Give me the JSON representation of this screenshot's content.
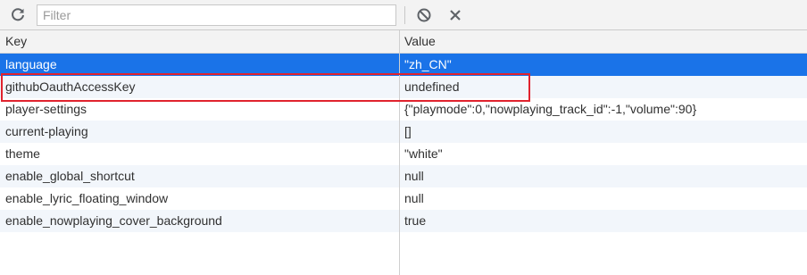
{
  "toolbar": {
    "filter_placeholder": "Filter",
    "refresh_icon": "refresh-icon",
    "clear_icon": "block-icon",
    "close_icon": "close-icon"
  },
  "table": {
    "columns": [
      "Key",
      "Value"
    ],
    "rows": [
      {
        "key": "language",
        "value": "\"zh_CN\""
      },
      {
        "key": "githubOauthAccessKey",
        "value": "undefined"
      },
      {
        "key": "player-settings",
        "value": "{\"playmode\":0,\"nowplaying_track_id\":-1,\"volume\":90}"
      },
      {
        "key": "current-playing",
        "value": "[]"
      },
      {
        "key": "theme",
        "value": "\"white\""
      },
      {
        "key": "enable_global_shortcut",
        "value": "null"
      },
      {
        "key": "enable_lyric_floating_window",
        "value": "null"
      },
      {
        "key": "enable_nowplaying_cover_background",
        "value": "true"
      }
    ]
  },
  "colors": {
    "selected_row": "#1a73e8",
    "highlight_box": "#e0232e",
    "alt_row": "#f2f6fb"
  }
}
